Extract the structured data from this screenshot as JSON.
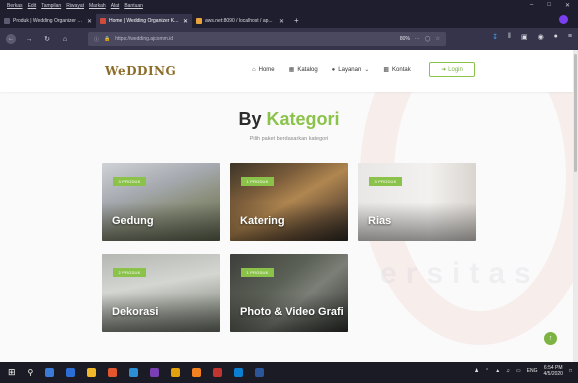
{
  "browser": {
    "menu": [
      "Berkas",
      "Edit",
      "Tampilan",
      "Riwayat",
      "Markah",
      "Alat",
      "Bantuan"
    ],
    "tabs": [
      {
        "title": "Produk | Wedding Organizer Kabu...",
        "active": false
      },
      {
        "title": "Home | Wedding Organizer K...",
        "active": true
      },
      {
        "title": "aws.net:8090 / localhost / ap...",
        "active": false
      }
    ],
    "url": "https://wedding.ajcomm.id",
    "zoom": "80%"
  },
  "site": {
    "logo": "WeDDING",
    "nav": [
      {
        "label": "Home",
        "icon": "home-icon"
      },
      {
        "label": "Katalog",
        "icon": "book-icon"
      },
      {
        "label": "Layanan",
        "icon": "users-icon"
      },
      {
        "label": "Kontak",
        "icon": "contact-icon"
      }
    ],
    "login_label": "Login"
  },
  "section": {
    "title_prefix": "By",
    "title_accent": "Kategori",
    "subtitle": "Pilih paket berdasarkan kategori"
  },
  "categories": [
    {
      "name": "Gedung",
      "badge": "3 PRODUK"
    },
    {
      "name": "Katering",
      "badge": "1 PRODUK"
    },
    {
      "name": "Rias",
      "badge": "3 PRODUK"
    },
    {
      "name": "Dekorasi",
      "badge": "2 PRODUK"
    },
    {
      "name": "Photo & Video Grafi",
      "badge": "1 PRODUK"
    }
  ],
  "taskbar": {
    "lang": "ENG",
    "time": "6:54 PM",
    "date": "4/5/2020"
  },
  "colors": {
    "accent": "#8bc34a",
    "chrome": "#1f1e2e",
    "logo": "#8b6d2a"
  }
}
